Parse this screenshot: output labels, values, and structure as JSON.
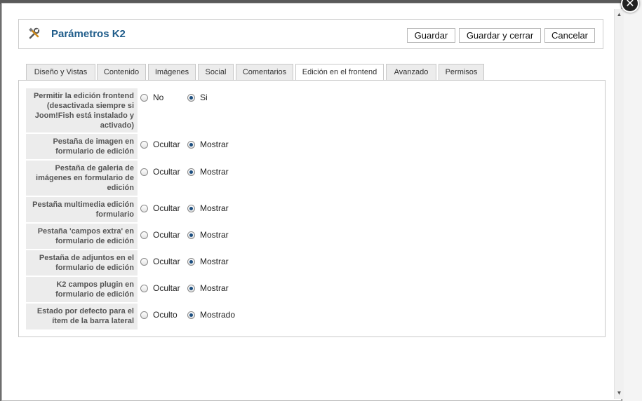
{
  "header": {
    "title": "Parámetros K2",
    "save_label": "Guardar",
    "save_close_label": "Guardar y cerrar",
    "cancel_label": "Cancelar"
  },
  "tabs": [
    {
      "label": "Diseño y Vistas"
    },
    {
      "label": "Contenido"
    },
    {
      "label": "Imágenes"
    },
    {
      "label": "Social"
    },
    {
      "label": "Comentarios"
    },
    {
      "label": "Edición en el frontend"
    },
    {
      "label": "Avanzado"
    },
    {
      "label": "Permisos"
    }
  ],
  "active_tab": "Edición en el frontend",
  "rows": [
    {
      "label": "Permitir la edición frontend (desactivada siempre si Joom!Fish está instalado y activado)",
      "options": [
        "No",
        "Si"
      ],
      "selected": "Si"
    },
    {
      "label": "Pestaña de imagen en formulario de edición",
      "options": [
        "Ocultar",
        "Mostrar"
      ],
      "selected": "Mostrar"
    },
    {
      "label": "Pestaña de galeria de imágenes en formulario de edición",
      "options": [
        "Ocultar",
        "Mostrar"
      ],
      "selected": "Mostrar"
    },
    {
      "label": "Pestaña multimedia edición formulario",
      "options": [
        "Ocultar",
        "Mostrar"
      ],
      "selected": "Mostrar"
    },
    {
      "label": "Pestaña 'campos extra' en formulario de edición",
      "options": [
        "Ocultar",
        "Mostrar"
      ],
      "selected": "Mostrar"
    },
    {
      "label": "Pestaña de adjuntos en el formulario de edición",
      "options": [
        "Ocultar",
        "Mostrar"
      ],
      "selected": "Mostrar"
    },
    {
      "label": "K2 campos plugin en formulario de edición",
      "options": [
        "Ocultar",
        "Mostrar"
      ],
      "selected": "Mostrar"
    },
    {
      "label": "Estado por defecto para el ítem de la barra lateral",
      "options": [
        "Oculto",
        "Mostrado"
      ],
      "selected": "Mostrado"
    }
  ],
  "icons": {
    "toolbar": "tools-icon",
    "close": "close-icon"
  },
  "colors": {
    "title": "#1f5c8a",
    "radio_dot": "#1d4f80",
    "label_bg": "#ececec"
  }
}
